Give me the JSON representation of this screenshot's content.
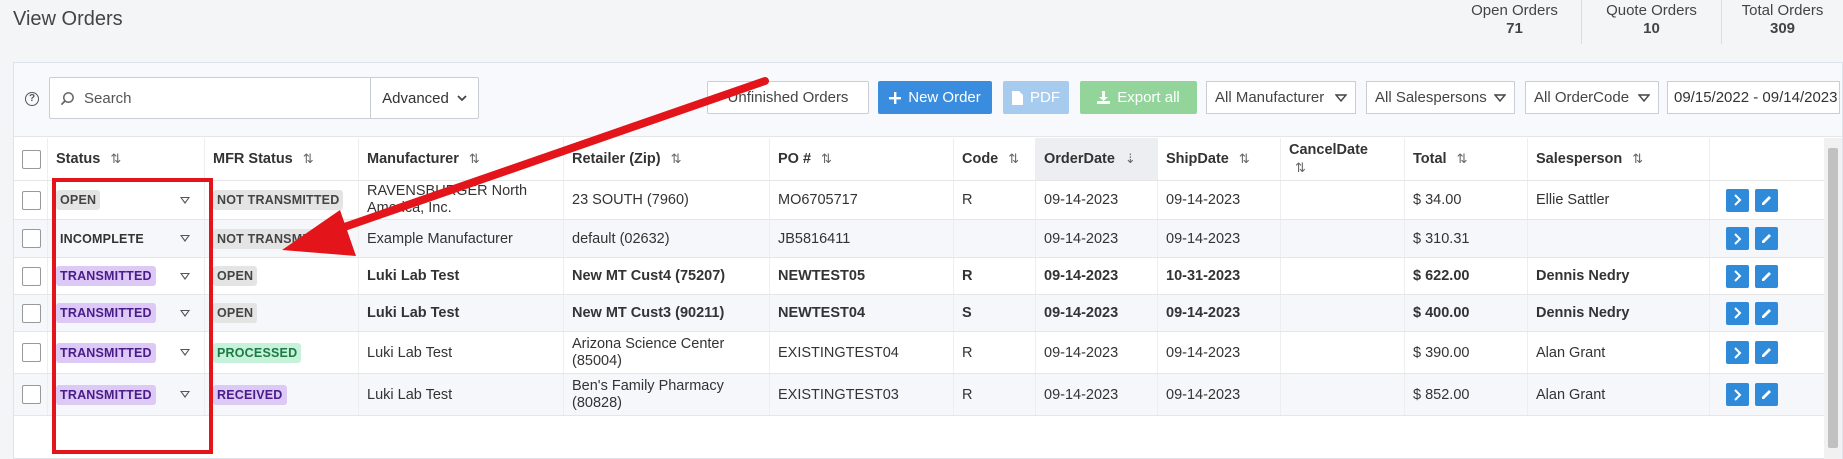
{
  "page": {
    "title": "View Orders"
  },
  "stats": [
    {
      "label": "Open Orders",
      "value": "71"
    },
    {
      "label": "Quote Orders",
      "value": "10"
    },
    {
      "label": "Total Orders",
      "value": "309"
    }
  ],
  "toolbar": {
    "help_icon": "question-circle-icon",
    "search_placeholder": "Search",
    "advanced_label": "Advanced",
    "unfinished_label": "Unfinished Orders",
    "new_order_label": "New Order",
    "pdf_label": "PDF",
    "export_label": "Export all",
    "manufacturer_filter": "All Manufacturer",
    "salesperson_filter": "All Salespersons",
    "ordercode_filter": "All OrderCode",
    "date_range": "09/15/2022 - 09/14/2023"
  },
  "table": {
    "headers": {
      "status": "Status",
      "mfr_status": "MFR Status",
      "manufacturer": "Manufacturer",
      "retailer": "Retailer (Zip)",
      "po": "PO #",
      "code": "Code",
      "order_date": "OrderDate",
      "ship_date": "ShipDate",
      "cancel_date": "CancelDate",
      "total": "Total",
      "salesperson": "Salesperson"
    },
    "rows": [
      {
        "status": "OPEN",
        "mfr_status": "NOT TRANSMITTED",
        "manufacturer": "RAVENSBURGER North America, Inc.",
        "retailer": "23 SOUTH (7960)",
        "po": "MO6705717",
        "code": "R",
        "order_date": "09-14-2023",
        "ship_date": "09-14-2023",
        "cancel_date": "",
        "total": "$ 34.00",
        "salesperson": "Ellie Sattler"
      },
      {
        "status": "INCOMPLETE",
        "mfr_status": "NOT TRANSMITTED",
        "manufacturer": "Example Manufacturer",
        "retailer": "default (02632)",
        "po": "JB5816411",
        "code": "",
        "order_date": "09-14-2023",
        "ship_date": "09-14-2023",
        "cancel_date": "",
        "total": "$ 310.31",
        "salesperson": ""
      },
      {
        "status": "TRANSMITTED",
        "mfr_status": "OPEN",
        "manufacturer": "Luki Lab Test",
        "retailer": "New MT Cust4 (75207)",
        "po": "NEWTEST05",
        "code": "R",
        "order_date": "09-14-2023",
        "ship_date": "10-31-2023",
        "cancel_date": "",
        "total": "$ 622.00",
        "salesperson": "Dennis Nedry"
      },
      {
        "status": "TRANSMITTED",
        "mfr_status": "OPEN",
        "manufacturer": "Luki Lab Test",
        "retailer": "New MT Cust3 (90211)",
        "po": "NEWTEST04",
        "code": "S",
        "order_date": "09-14-2023",
        "ship_date": "09-14-2023",
        "cancel_date": "",
        "total": "$ 400.00",
        "salesperson": "Dennis Nedry"
      },
      {
        "status": "TRANSMITTED",
        "mfr_status": "PROCESSED",
        "manufacturer": "Luki Lab Test",
        "retailer": "Arizona Science Center (85004)",
        "po": "EXISTINGTEST04",
        "code": "R",
        "order_date": "09-14-2023",
        "ship_date": "09-14-2023",
        "cancel_date": "",
        "total": "$ 390.00",
        "salesperson": "Alan Grant"
      },
      {
        "status": "TRANSMITTED",
        "mfr_status": "RECEIVED",
        "manufacturer": "Luki Lab Test",
        "retailer": "Ben's Family Pharmacy (80828)",
        "po": "EXISTINGTEST03",
        "code": "R",
        "order_date": "09-14-2023",
        "ship_date": "09-14-2023",
        "cancel_date": "",
        "total": "$ 852.00",
        "salesperson": "Alan Grant"
      }
    ]
  },
  "colors": {
    "primary": "#3a8dde",
    "annotation_red": "#e3141a",
    "badge_purple": "#dcc9f5",
    "badge_green": "#c6f2d9"
  }
}
